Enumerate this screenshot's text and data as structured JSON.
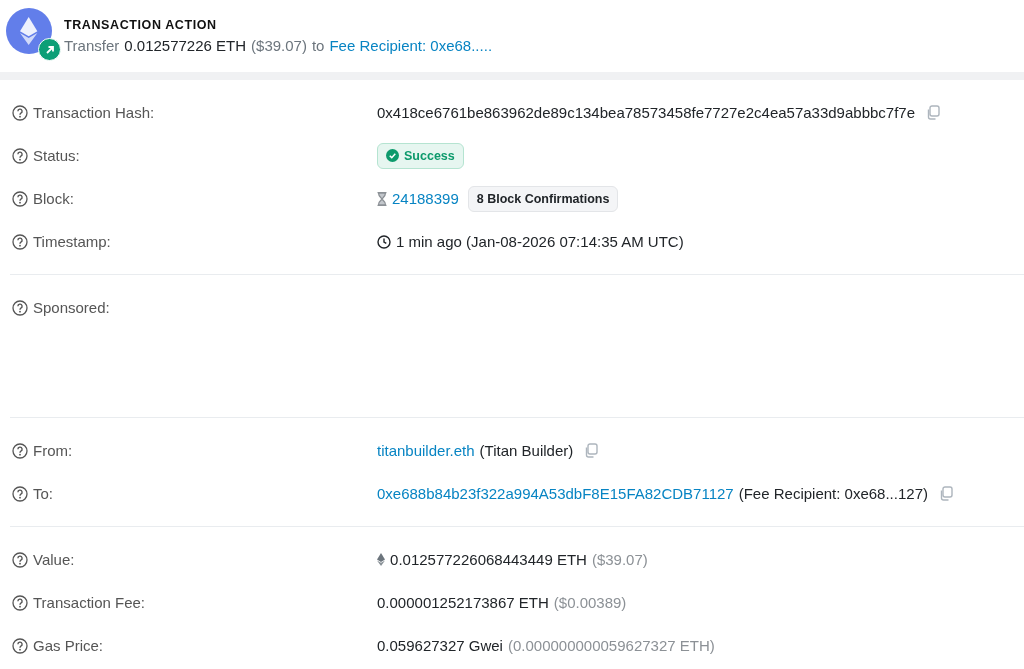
{
  "header": {
    "title": "TRANSACTION ACTION",
    "verb": "Transfer",
    "amount": "0.012577226 ETH",
    "usd": "($39.07)",
    "connector": "to",
    "link": "Fee Recipient: 0xe68....."
  },
  "sections": [
    {
      "rows": [
        {
          "label": "Transaction Hash:",
          "kind": "plain",
          "copy": true,
          "parts": [
            {
              "text": "0x418ce6761be863962de89c134bea78573458fe7727e2c4ea57a33d9abbbc7f7e",
              "kind": "normal"
            }
          ]
        },
        {
          "label": "Status:",
          "kind": "status",
          "badge": "Success"
        },
        {
          "label": "Block:",
          "kind": "block",
          "parts": [
            {
              "text": "24188399",
              "kind": "link"
            }
          ],
          "badge": "8 Block Confirmations"
        },
        {
          "label": "Timestamp:",
          "kind": "time",
          "parts": [
            {
              "text": "1 min ago (Jan-08-2026 07:14:35 AM UTC)",
              "kind": "normal"
            }
          ]
        }
      ]
    },
    {
      "tall": true,
      "rows": [
        {
          "label": "Sponsored:",
          "kind": "blank"
        }
      ]
    },
    {
      "rows": [
        {
          "label": "From:",
          "kind": "plain",
          "copy": true,
          "parts": [
            {
              "text": "titanbuilder.eth",
              "kind": "link"
            },
            {
              "text": "(Titan Builder)",
              "kind": "normal"
            }
          ]
        },
        {
          "label": "To:",
          "kind": "plain",
          "copy": true,
          "parts": [
            {
              "text": "0xe688b84b23f322a994A53dbF8E15FA82CDB71127",
              "kind": "link"
            },
            {
              "text": "(Fee Recipient: 0xe68...127)",
              "kind": "normal"
            }
          ]
        }
      ]
    },
    {
      "rows": [
        {
          "label": "Value:",
          "kind": "value",
          "parts": [
            {
              "text": "0.012577226068443449 ETH",
              "kind": "normal"
            },
            {
              "text": "($39.07)",
              "kind": "muted"
            }
          ]
        },
        {
          "label": "Transaction Fee:",
          "kind": "plain",
          "parts": [
            {
              "text": "0.000001252173867 ETH",
              "kind": "normal"
            },
            {
              "text": "($0.00389)",
              "kind": "muted"
            }
          ]
        },
        {
          "label": "Gas Price:",
          "kind": "plain",
          "parts": [
            {
              "text": "0.059627327 Gwei",
              "kind": "normal"
            },
            {
              "text": "(0.000000000059627327 ETH)",
              "kind": "muted"
            }
          ]
        }
      ]
    }
  ]
}
